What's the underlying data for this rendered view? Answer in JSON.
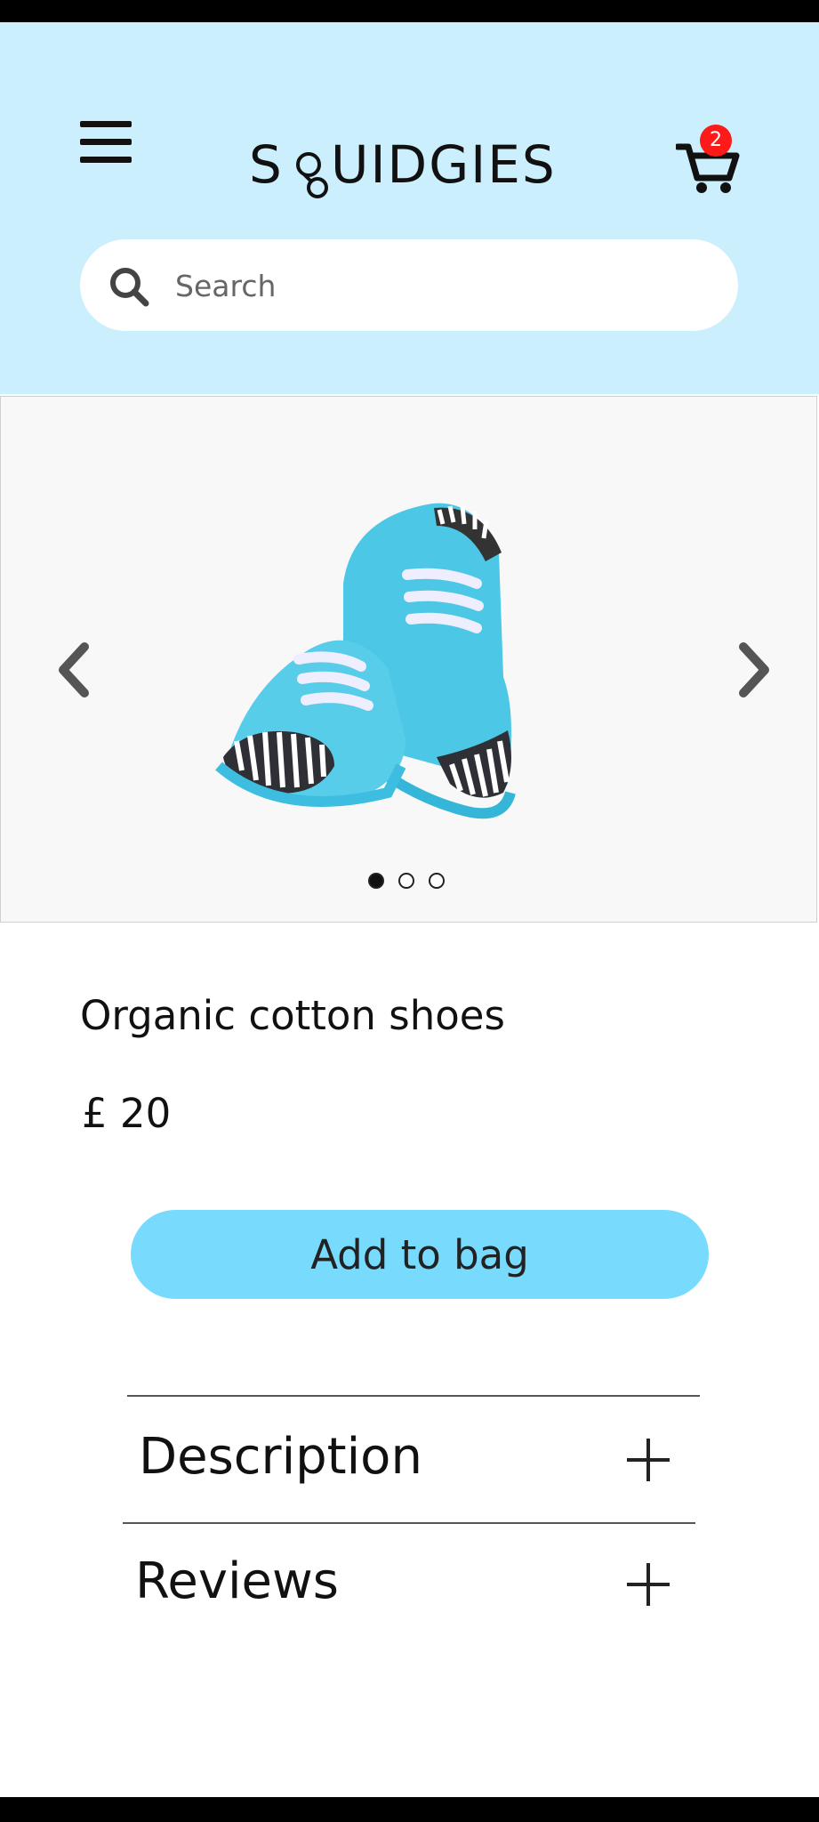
{
  "header": {
    "brand": "SQUIDGIES",
    "cart_count": "2",
    "background_color": "#cbeffc"
  },
  "search": {
    "placeholder": "Search",
    "value": ""
  },
  "carousel": {
    "slide_count": 3,
    "active_slide": 1,
    "image_icon": "blue-baby-shoes"
  },
  "product": {
    "title": "Organic cotton shoes",
    "price": "£ 20",
    "add_label": "Add to bag",
    "accent_color": "#78dafd"
  },
  "accordion": [
    {
      "label": "Description",
      "expanded": false
    },
    {
      "label": "Reviews",
      "expanded": false
    }
  ]
}
